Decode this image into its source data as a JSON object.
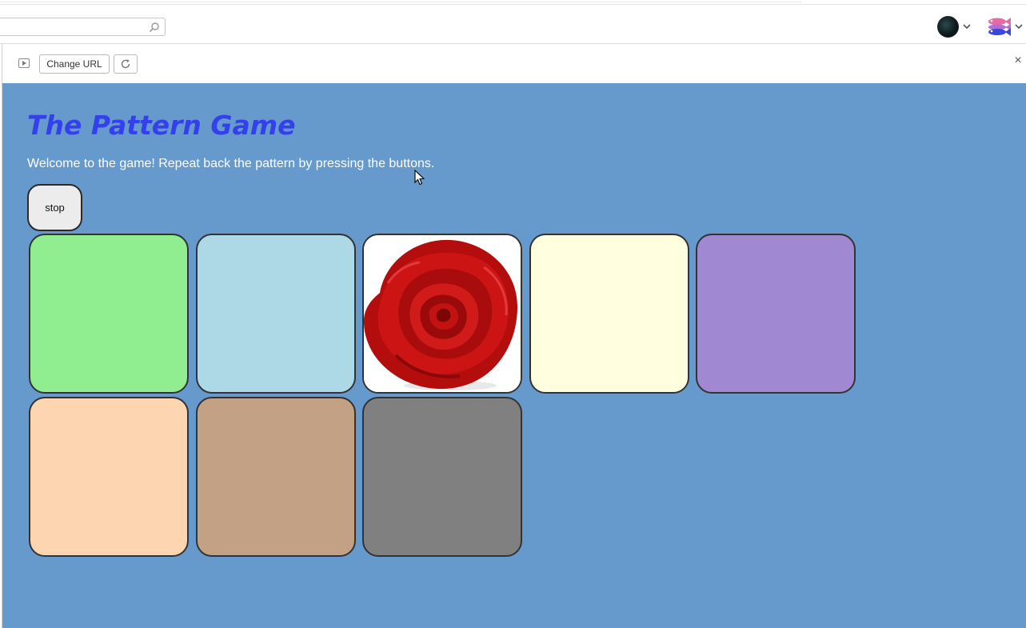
{
  "browser": {
    "search_placeholder": "",
    "icons": {
      "search": "search-icon",
      "chevron": "chevron-down-icon",
      "account": "avatar",
      "close": "close-icon",
      "refresh": "refresh-icon",
      "play": "play-icon"
    }
  },
  "toolbar": {
    "change_url_label": "Change URL",
    "close_label": "×"
  },
  "game": {
    "title": "The Pattern Game",
    "description": "Welcome to the game! Repeat back the pattern by pressing the buttons.",
    "stop_label": "stop",
    "background_color": "#6699cc",
    "title_color": "#3440ee",
    "buttons": [
      {
        "id": 1,
        "color": "#90ee90",
        "state": "idle"
      },
      {
        "id": 2,
        "color": "#add8e6",
        "state": "idle"
      },
      {
        "id": 3,
        "color": "#ffffff",
        "state": "lit",
        "image": "red-rose"
      },
      {
        "id": 4,
        "color": "#ffffe0",
        "state": "idle"
      },
      {
        "id": 5,
        "color": "#a088d2",
        "state": "idle"
      },
      {
        "id": 6,
        "color": "#fdd5b1",
        "state": "idle"
      },
      {
        "id": 7,
        "color": "#c2a184",
        "state": "idle"
      },
      {
        "id": 8,
        "color": "#808080",
        "state": "idle"
      }
    ]
  }
}
